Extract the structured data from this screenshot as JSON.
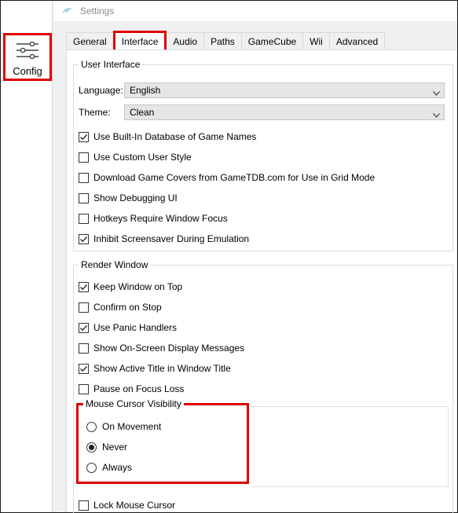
{
  "sidebar": {
    "config_label": "Config"
  },
  "window": {
    "title": "Settings"
  },
  "tabs": [
    "General",
    "Interface",
    "Audio",
    "Paths",
    "GameCube",
    "Wii",
    "Advanced"
  ],
  "user_interface": {
    "title": "User Interface",
    "language_label": "Language:",
    "language_value": "English",
    "theme_label": "Theme:",
    "theme_value": "Clean",
    "options": [
      {
        "label": "Use Built-In Database of Game Names",
        "checked": true
      },
      {
        "label": "Use Custom User Style",
        "checked": false
      },
      {
        "label": "Download Game Covers from GameTDB.com for Use in Grid Mode",
        "checked": false
      },
      {
        "label": "Show Debugging UI",
        "checked": false
      },
      {
        "label": "Hotkeys Require Window Focus",
        "checked": false
      },
      {
        "label": "Inhibit Screensaver During Emulation",
        "checked": true
      }
    ]
  },
  "render_window": {
    "title": "Render Window",
    "options": [
      {
        "label": "Keep Window on Top",
        "checked": true
      },
      {
        "label": "Confirm on Stop",
        "checked": false
      },
      {
        "label": "Use Panic Handlers",
        "checked": true
      },
      {
        "label": "Show On-Screen Display Messages",
        "checked": false
      },
      {
        "label": "Show Active Title in Window Title",
        "checked": true
      },
      {
        "label": "Pause on Focus Loss",
        "checked": false
      }
    ],
    "cursor_visibility": {
      "title": "Mouse Cursor Visibility",
      "options": [
        {
          "label": "On Movement",
          "selected": false
        },
        {
          "label": "Never",
          "selected": true
        },
        {
          "label": "Always",
          "selected": false
        }
      ]
    },
    "lock_cursor": {
      "label": "Lock Mouse Cursor",
      "checked": false
    }
  },
  "colors": {
    "highlight": "#e00000",
    "panel": "#ffffff",
    "chrome": "#f0f0f0"
  }
}
